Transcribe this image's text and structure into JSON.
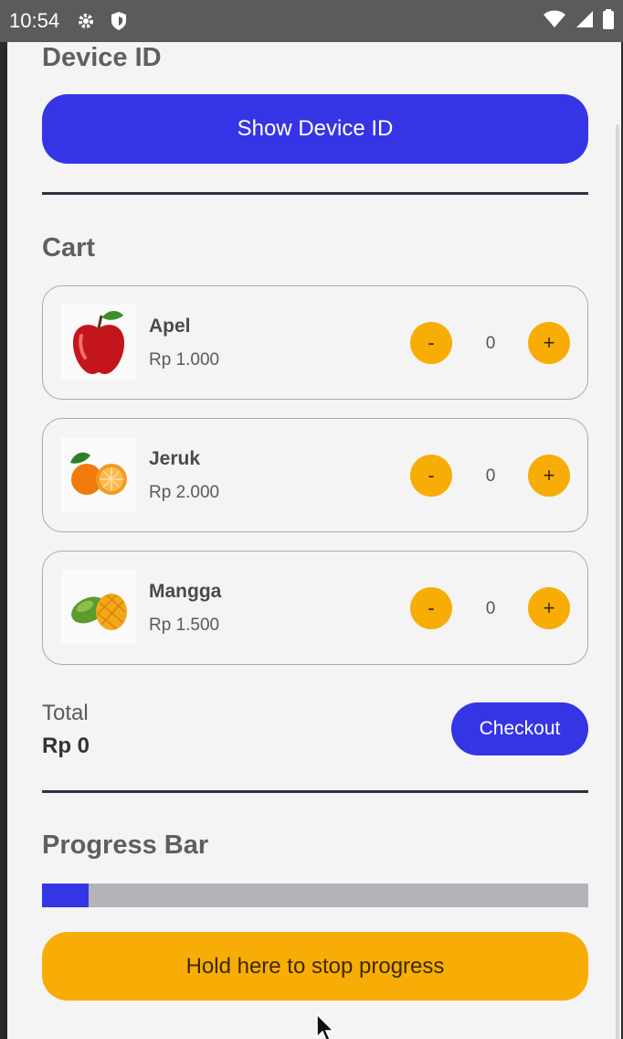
{
  "status_bar": {
    "time": "10:54",
    "icons": [
      "gear-icon",
      "shield-icon",
      "wifi-icon",
      "signal-icon",
      "battery-icon"
    ]
  },
  "device_section": {
    "title": "Device ID",
    "button_label": "Show Device ID"
  },
  "cart": {
    "title": "Cart",
    "items": [
      {
        "name": "Apel",
        "price": "Rp 1.000",
        "qty": "0",
        "minus": "-",
        "plus": "+",
        "image": "apple"
      },
      {
        "name": "Jeruk",
        "price": "Rp 2.000",
        "qty": "0",
        "minus": "-",
        "plus": "+",
        "image": "orange"
      },
      {
        "name": "Mangga",
        "price": "Rp 1.500",
        "qty": "0",
        "minus": "-",
        "plus": "+",
        "image": "mango"
      }
    ],
    "total_label": "Total",
    "total_value": "Rp 0",
    "checkout_label": "Checkout"
  },
  "progress_section": {
    "title": "Progress Bar",
    "progress_fraction": 0.085,
    "hold_button_label": "Hold here to stop progress"
  },
  "colors": {
    "primary": "#3535e6",
    "accent": "#f7ad05",
    "track": "#b2b4b9"
  }
}
